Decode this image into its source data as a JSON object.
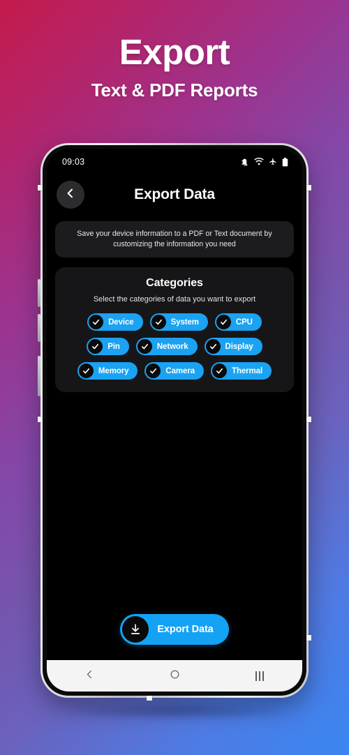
{
  "promo": {
    "title": "Export",
    "subtitle": "Text & PDF Reports"
  },
  "colors": {
    "accent": "#1ba2f2",
    "export_button": "#14a2f5",
    "screen_background": "#000000",
    "card_background": "#161618",
    "info_card_background": "#1c1c1e",
    "gradient_start": "#c41b4b",
    "gradient_mid": "#7655ad",
    "gradient_end": "#3a86f2",
    "navbar_background": "#f4f4f4"
  },
  "phone": {
    "status_bar": {
      "time": "09:03",
      "icons": [
        "mute-icon",
        "wifi-icon",
        "airplane-mode-icon",
        "battery-icon"
      ]
    },
    "app_header": {
      "back_icon": "chevron-left-icon",
      "title": "Export Data"
    },
    "info_card": {
      "text": "Save your device information to a PDF or Text document by customizing the information you need"
    },
    "categories_card": {
      "title": "Categories",
      "subtitle": "Select the categories of data you want to export",
      "rows": [
        [
          {
            "label": "Device",
            "checked": true
          },
          {
            "label": "System",
            "checked": true
          },
          {
            "label": "CPU",
            "checked": true
          }
        ],
        [
          {
            "label": "Pin",
            "checked": true
          },
          {
            "label": "Network",
            "checked": true
          },
          {
            "label": "Display",
            "checked": true
          }
        ],
        [
          {
            "label": "Memory",
            "checked": true
          },
          {
            "label": "Camera",
            "checked": true
          },
          {
            "label": "Thermal",
            "checked": true
          }
        ]
      ]
    },
    "export_button": {
      "label": "Export Data",
      "icon": "download-icon"
    },
    "nav_bar": {
      "back": "back-icon",
      "home": "home-icon",
      "recents": "recents-icon"
    }
  }
}
